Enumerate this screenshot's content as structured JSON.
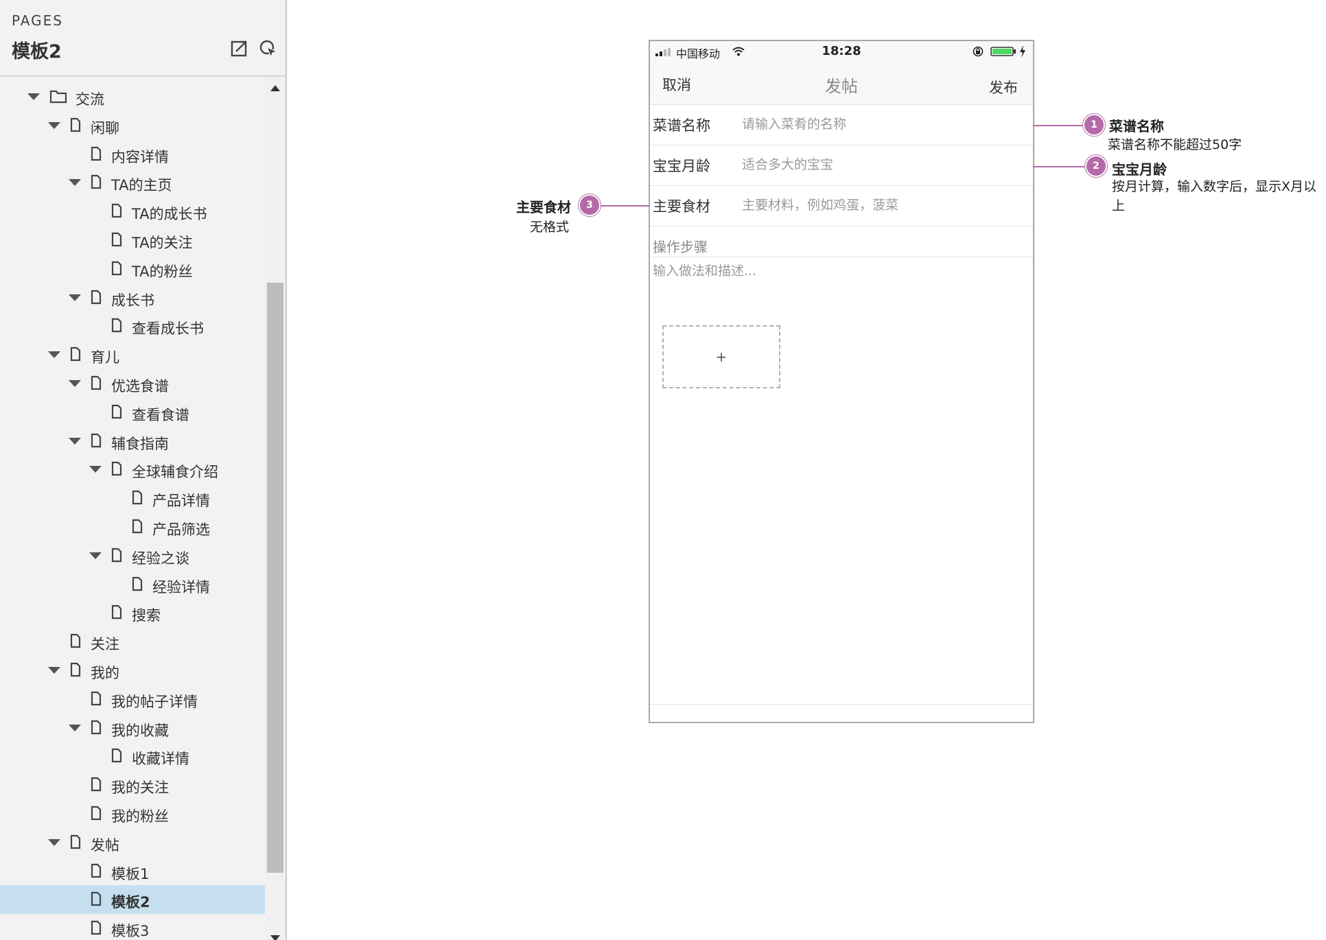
{
  "sidebar": {
    "section_label": "PAGES",
    "project_title": "模板2",
    "tree": [
      {
        "label": "交流",
        "depth": 0,
        "type": "folder",
        "expanded": true
      },
      {
        "label": "闲聊",
        "depth": 1,
        "type": "page",
        "expanded": true
      },
      {
        "label": "内容详情",
        "depth": 2,
        "type": "page"
      },
      {
        "label": "TA的主页",
        "depth": 2,
        "type": "page",
        "expanded": true
      },
      {
        "label": "TA的成长书",
        "depth": 3,
        "type": "page"
      },
      {
        "label": "TA的关注",
        "depth": 3,
        "type": "page"
      },
      {
        "label": "TA的粉丝",
        "depth": 3,
        "type": "page"
      },
      {
        "label": "成长书",
        "depth": 2,
        "type": "page",
        "expanded": true
      },
      {
        "label": "查看成长书",
        "depth": 3,
        "type": "page"
      },
      {
        "label": "育儿",
        "depth": 1,
        "type": "page",
        "expanded": true
      },
      {
        "label": "优选食谱",
        "depth": 2,
        "type": "page",
        "expanded": true
      },
      {
        "label": "查看食谱",
        "depth": 3,
        "type": "page"
      },
      {
        "label": "辅食指南",
        "depth": 2,
        "type": "page",
        "expanded": true
      },
      {
        "label": "全球辅食介绍",
        "depth": 3,
        "type": "page",
        "expanded": true
      },
      {
        "label": "产品详情",
        "depth": 4,
        "type": "page"
      },
      {
        "label": "产品筛选",
        "depth": 4,
        "type": "page"
      },
      {
        "label": "经验之谈",
        "depth": 3,
        "type": "page",
        "expanded": true
      },
      {
        "label": "经验详情",
        "depth": 4,
        "type": "page"
      },
      {
        "label": "搜索",
        "depth": 3,
        "type": "page"
      },
      {
        "label": "关注",
        "depth": 1,
        "type": "page"
      },
      {
        "label": "我的",
        "depth": 1,
        "type": "page",
        "expanded": true
      },
      {
        "label": "我的帖子详情",
        "depth": 2,
        "type": "page"
      },
      {
        "label": "我的收藏",
        "depth": 2,
        "type": "page",
        "expanded": true
      },
      {
        "label": "收藏详情",
        "depth": 3,
        "type": "page"
      },
      {
        "label": "我的关注",
        "depth": 2,
        "type": "page"
      },
      {
        "label": "我的粉丝",
        "depth": 2,
        "type": "page"
      },
      {
        "label": "发帖",
        "depth": 1,
        "type": "page",
        "expanded": true
      },
      {
        "label": "模板1",
        "depth": 2,
        "type": "page"
      },
      {
        "label": "模板2",
        "depth": 2,
        "type": "page",
        "selected": true
      },
      {
        "label": "模板3",
        "depth": 2,
        "type": "page"
      }
    ]
  },
  "phone": {
    "status": {
      "carrier": "中国移动",
      "time": "18:28"
    },
    "nav": {
      "cancel": "取消",
      "title": "发帖",
      "publish": "发布"
    },
    "fields": [
      {
        "label": "菜谱名称",
        "placeholder": "请输入菜肴的名称"
      },
      {
        "label": "宝宝月龄",
        "placeholder": "适合多大的宝宝"
      },
      {
        "label": "主要食材",
        "placeholder": "主要材料，例如鸡蛋，菠菜"
      }
    ],
    "steps": {
      "label": "操作步骤",
      "placeholder": "输入做法和描述..."
    },
    "upload_symbol": "+"
  },
  "annotations": [
    {
      "number": "1",
      "title": "菜谱名称",
      "desc": "菜谱名称不能超过50字"
    },
    {
      "number": "2",
      "title": "宝宝月龄",
      "desc": "按月计算，输入数字后，显示X月以上"
    },
    {
      "number": "3",
      "title": "主要食材",
      "desc": "无格式"
    }
  ],
  "colors": {
    "annotation": "#b46aa8",
    "selected_row": "#c5dff0",
    "battery": "#4cd964"
  },
  "icons": {
    "toolbar": [
      "export-icon",
      "pointer-icon"
    ],
    "tree": [
      "folder-icon",
      "page-icon",
      "caret-down-icon"
    ]
  }
}
